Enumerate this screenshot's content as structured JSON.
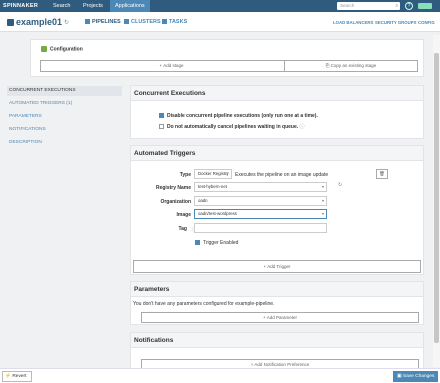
{
  "topnav": {
    "logo": "SPINNAKER",
    "items": [
      "Search",
      "Projects",
      "Applications"
    ],
    "search_placeholder": "Search",
    "help": "?"
  },
  "app": {
    "name": "example01",
    "tabs": [
      "PIPELINES",
      "CLUSTERS",
      "TASKS"
    ],
    "right_links": [
      "LOAD BALANCERS",
      "SECURITY GROUPS",
      "CONFIG"
    ]
  },
  "config": {
    "title": "Configuration",
    "add_stage": "Add stage",
    "copy_stage": "Copy an existing stage"
  },
  "sidenav": [
    "CONCURRENT EXECUTIONS",
    "AUTOMATED TRIGGERS (1)",
    "PARAMETERS",
    "NOTIFICATIONS",
    "DESCRIPTION"
  ],
  "concurrent": {
    "title": "Concurrent Executions",
    "opt1": "Disable concurrent pipeline executions (only run one at a time).",
    "opt2": "Do not automatically cancel pipelines waiting in queue."
  },
  "triggers": {
    "title": "Automated Triggers",
    "type_label": "Type",
    "type_value": "Docker Registry",
    "type_desc": "Executes the pipeline on an image update",
    "registry_label": "Registry Name",
    "registry_value": "test-hybern-net",
    "org_label": "Organization",
    "org_value": "oadn",
    "image_label": "Image",
    "image_value": "oadn/test-wordpress",
    "tag_label": "Tag",
    "trigger_enabled": "Trigger Enabled",
    "add_trigger": "Add Trigger"
  },
  "parameters": {
    "title": "Parameters",
    "empty": "You don't have any parameters configured for example-pipeline.",
    "add": "Add Parameter"
  },
  "notifications": {
    "title": "Notifications",
    "add": "Add Notification Preference"
  },
  "footer": {
    "revert": "Revert",
    "save": "Save Changes"
  },
  "colors": {
    "topbar": "#2f5c7e",
    "accent": "#4b88b6"
  }
}
